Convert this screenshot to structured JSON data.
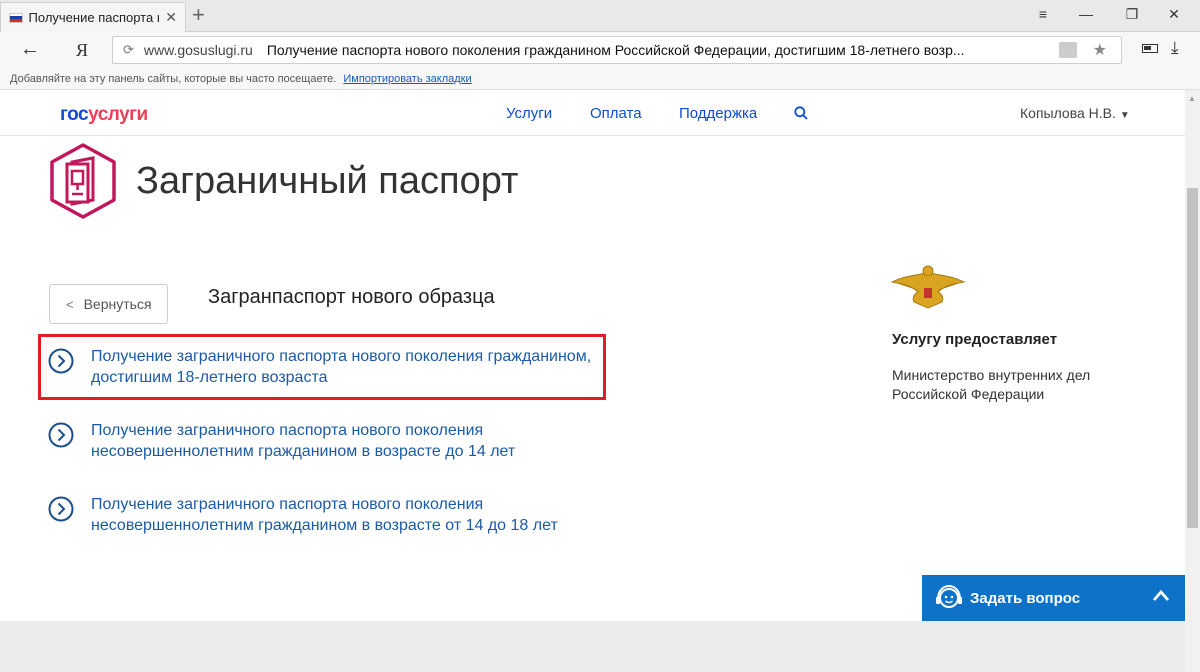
{
  "browser": {
    "tab_title": "Получение паспорта но",
    "tab_close": "✕",
    "new_tab": "+",
    "window_controls": [
      "≡",
      "—",
      "❐",
      "✕"
    ],
    "back": "←",
    "brand_letter": "Я",
    "url_domain": "www.gosuslugi.ru",
    "url_title": "Получение паспорта нового поколения гражданином Российской Федерации, достигшим 18-летнего возр...",
    "bookmarks_text": "Добавляйте на эту панель сайты, которые вы часто посещаете.",
    "bookmarks_link": "Импортировать закладки",
    "flag_colors": [
      "#ffffff",
      "#1c3fb0",
      "#d52b1e"
    ]
  },
  "site": {
    "logo_part1": "гос",
    "logo_part2": "услуги",
    "nav": [
      "Услуги",
      "Оплата",
      "Поддержка"
    ],
    "user": "Копылова Н.В.",
    "brand_blue": "#0d4cd3",
    "brand_red": "#ee3f58"
  },
  "page": {
    "title": "Заграничный паспорт",
    "back_label": "Вернуться",
    "section_title": "Загранпаспорт нового образца",
    "services": [
      {
        "line1": "Получение заграничного паспорта нового поколения гражданином,",
        "line2": "достигшим 18-летнего возраста"
      },
      {
        "line1": "Получение заграничного паспорта нового поколения",
        "line2": "несовершеннолетним гражданином в возрасте до 14 лет"
      },
      {
        "line1": "Получение заграничного паспорта нового поколения",
        "line2": "несовершеннолетним гражданином в возрасте от 14 до 18 лет"
      }
    ],
    "provider_label": "Услугу предоставляет",
    "provider_line1": "Министерство внутренних дел",
    "provider_line2": "Российской Федерации",
    "highlight_color": "#e01d25"
  },
  "chat": {
    "label": "Задать вопрос",
    "color": "#0e72c8"
  }
}
